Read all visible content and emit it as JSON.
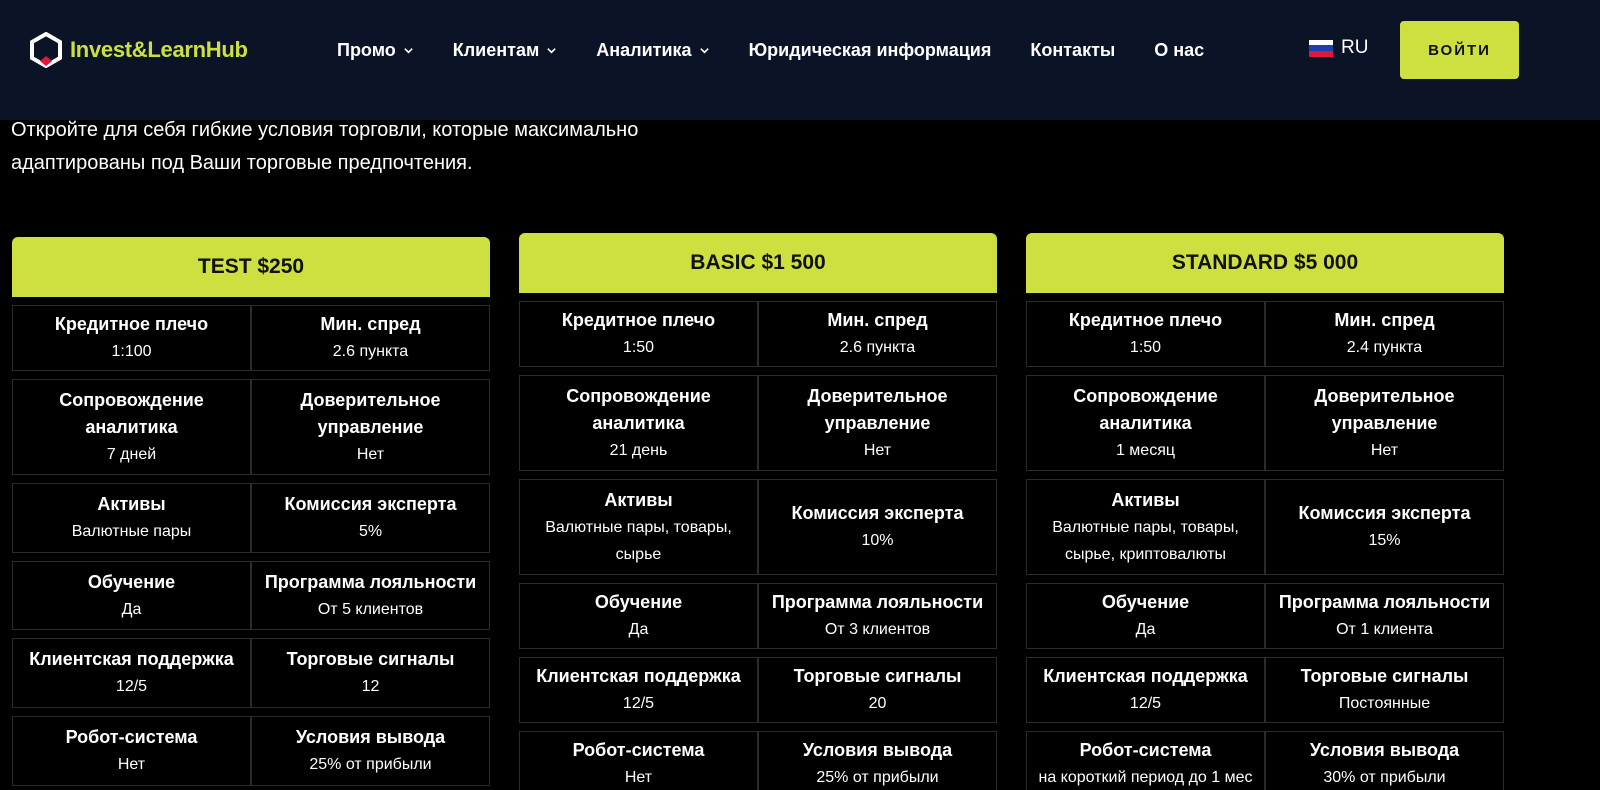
{
  "header": {
    "logo_text": "Invest&LearnHub",
    "nav": [
      {
        "label": "Промо",
        "dropdown": true
      },
      {
        "label": "Клиентам",
        "dropdown": true
      },
      {
        "label": "Аналитика",
        "dropdown": true
      },
      {
        "label": "Юридическая информация",
        "dropdown": false
      },
      {
        "label": "Контакты",
        "dropdown": false
      },
      {
        "label": "О нас",
        "dropdown": false
      }
    ],
    "lang": "RU",
    "login_label": "ВОЙТИ",
    "accent_color": "#cde040"
  },
  "intro": {
    "line1": "Откройте для себя гибкие условия торговли, которые максимально",
    "line2": "адаптированы под Ваши торговые предпочтения."
  },
  "plans": [
    {
      "title": "TEST $250",
      "rows": [
        [
          {
            "t": "Кредитное плечо",
            "v": "1:100"
          },
          {
            "t": "Мин. спред",
            "v": "2.6 пункта"
          }
        ],
        [
          {
            "t": "Сопровождение аналитика",
            "v": "7 дней"
          },
          {
            "t": "Доверительное управление",
            "v": "Нет"
          }
        ],
        [
          {
            "t": "Активы",
            "v": "Валютные пары"
          },
          {
            "t": "Комиссия эксперта",
            "v": "5%"
          }
        ],
        [
          {
            "t": "Обучение",
            "v": "Да"
          },
          {
            "t": "Программа лояльности",
            "v": "От 5 клиентов"
          }
        ],
        [
          {
            "t": "Клиентская поддержка",
            "v": "12/5"
          },
          {
            "t": "Торговые сигналы",
            "v": "12"
          }
        ],
        [
          {
            "t": "Робот-система",
            "v": "Нет"
          },
          {
            "t": "Условия вывода",
            "v": "25% от прибыли"
          }
        ]
      ]
    },
    {
      "title": "BASIC $1 500",
      "rows": [
        [
          {
            "t": "Кредитное плечо",
            "v": "1:50"
          },
          {
            "t": "Мин. спред",
            "v": "2.6 пункта"
          }
        ],
        [
          {
            "t": "Сопровождение аналитика",
            "v": "21 день"
          },
          {
            "t": "Доверительное управление",
            "v": "Нет"
          }
        ],
        [
          {
            "t": "Активы",
            "v": "Валютные пары, товары, сырье"
          },
          {
            "t": "Комиссия эксперта",
            "v": "10%"
          }
        ],
        [
          {
            "t": "Обучение",
            "v": "Да"
          },
          {
            "t": "Программа лояльности",
            "v": "От 3 клиентов"
          }
        ],
        [
          {
            "t": "Клиентская поддержка",
            "v": "12/5"
          },
          {
            "t": "Торговые сигналы",
            "v": "20"
          }
        ],
        [
          {
            "t": "Робот-система",
            "v": "Нет"
          },
          {
            "t": "Условия вывода",
            "v": "25% от прибыли"
          }
        ]
      ]
    },
    {
      "title": "STANDARD $5 000",
      "rows": [
        [
          {
            "t": "Кредитное плечо",
            "v": "1:50"
          },
          {
            "t": "Мин. спред",
            "v": "2.4 пункта"
          }
        ],
        [
          {
            "t": "Сопровождение аналитика",
            "v": "1 месяц"
          },
          {
            "t": "Доверительное управление",
            "v": "Нет"
          }
        ],
        [
          {
            "t": "Активы",
            "v": "Валютные пары, товары, сырье, криптовалюты"
          },
          {
            "t": "Комиссия эксперта",
            "v": "15%"
          }
        ],
        [
          {
            "t": "Обучение",
            "v": "Да"
          },
          {
            "t": "Программа лояльности",
            "v": "От 1 клиента"
          }
        ],
        [
          {
            "t": "Клиентская поддержка",
            "v": "12/5"
          },
          {
            "t": "Торговые сигналы",
            "v": "Постоянные"
          }
        ],
        [
          {
            "t": "Робот-система",
            "v": "на короткий период до 1 мес"
          },
          {
            "t": "Условия вывода",
            "v": "30% от прибыли"
          }
        ]
      ]
    }
  ]
}
